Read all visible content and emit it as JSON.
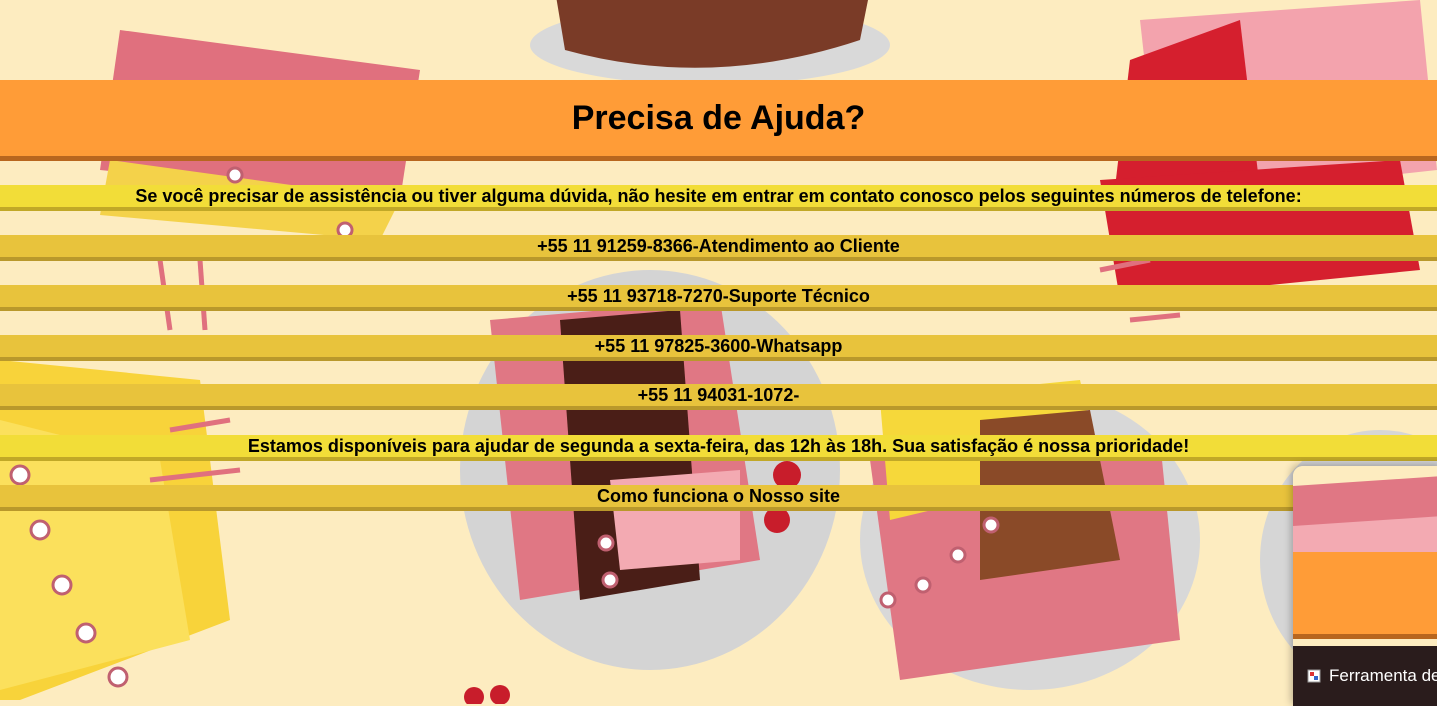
{
  "header": {
    "title": "Precisa de Ajuda?"
  },
  "intro": "Se você precisar de assistência ou tiver alguma dúvida, não hesite em entrar em contato conosco pelos seguintes números de telefone:",
  "phones": [
    "+55 11 91259-8366-Atendimento ao Cliente",
    "+55 11 93718-7270-Suporte Técnico",
    "+55 11 97825-3600-Whatsapp",
    "+55 11 94031-1072-"
  ],
  "availability": "Estamos disponíveis para ajudar de segunda a sexta-feira, das 12h às 18h. Sua satisfação é nossa prioridade!",
  "how_it_works": "Como funciona o Nosso site",
  "popup": {
    "label": "Ferramenta de",
    "icon": "tool-icon"
  },
  "colors": {
    "header_bg": "#ff9c37",
    "band_bg": "#e8c33c",
    "band_bright": "#f2dd38",
    "page_bg": "#fdecc0"
  }
}
